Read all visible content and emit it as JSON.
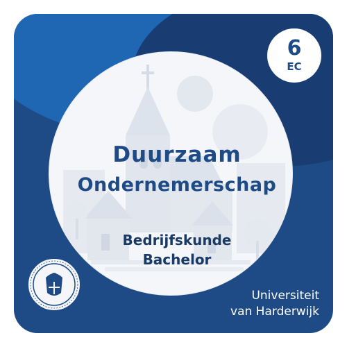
{
  "badge": {
    "number": "6",
    "unit": "EC"
  },
  "course": {
    "title_line1": "Duurzaam",
    "title_line2": "Ondernemerschap"
  },
  "program": {
    "line1": "Bedrijfskunde",
    "line2": "Bachelor"
  },
  "university": {
    "line1": "Universiteit",
    "line2": "van Harderwijk"
  },
  "colors": {
    "brand_blue": "#1e4b86",
    "accent_blue": "#1f66b3",
    "circle_bg": "#f4f6f9",
    "text_on_dark": "#ffffff"
  },
  "icons": {
    "seal": "university-seal-icon"
  }
}
